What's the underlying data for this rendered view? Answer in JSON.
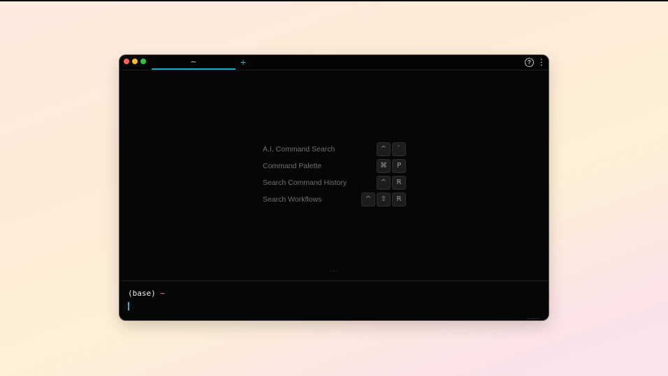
{
  "window": {
    "tabs": [
      {
        "label": "~",
        "active": true
      }
    ],
    "new_tab_symbol": "+",
    "help_symbol": "?",
    "menu_symbol": "⋮"
  },
  "shortcuts": [
    {
      "label": "A.I. Command Search",
      "keys": [
        "^",
        "`"
      ]
    },
    {
      "label": "Command Palette",
      "keys": [
        "⌘",
        "P"
      ]
    },
    {
      "label": "Search Command History",
      "keys": [
        "^",
        "R"
      ]
    },
    {
      "label": "Search Workflows",
      "keys": [
        "^",
        "⇧",
        "R"
      ]
    }
  ],
  "divider_handle": "···",
  "prompt": {
    "env": "(base)",
    "cwd": "~"
  },
  "colors": {
    "accent": "#1fa3c7",
    "prompt_path": "#e79ab8",
    "window_bg": "#060607"
  },
  "icons": [
    "close-dot",
    "minimize-dot",
    "zoom-dot",
    "plus-icon",
    "help-icon",
    "more-vertical-icon"
  ]
}
